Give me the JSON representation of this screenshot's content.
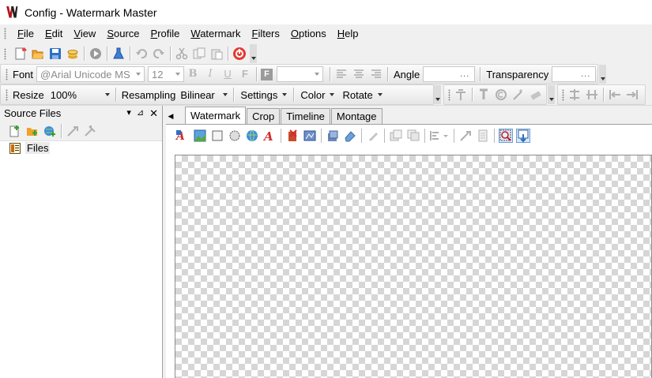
{
  "window": {
    "title": "Config - Watermark Master"
  },
  "menu": [
    "File",
    "Edit",
    "View",
    "Source",
    "Profile",
    "Watermark",
    "Filters",
    "Options",
    "Help"
  ],
  "toolbar_main": {
    "icons": [
      "new-icon",
      "open-icon",
      "save-icon",
      "coins-icon",
      "play-icon",
      "flask-icon",
      "undo-icon",
      "redo-icon",
      "cut-icon",
      "copy-icon",
      "paste-icon",
      "stop-icon"
    ]
  },
  "font_bar": {
    "font_label": "Font",
    "font_value": "@Arial Unicode MS",
    "size_value": "12",
    "bold": "B",
    "italic": "I",
    "underline": "U",
    "strike": "F",
    "frame": "F",
    "angle_label": "Angle",
    "angle_value": "...",
    "transparency_label": "Transparency",
    "transparency_value": "..."
  },
  "resize_bar": {
    "resize_label": "Resize",
    "resize_value": "100%",
    "resampling_label": "Resampling",
    "resampling_value": "Bilinear",
    "settings": "Settings",
    "color": "Color",
    "rotate": "Rotate"
  },
  "source_panel": {
    "title": "Source Files",
    "items": [
      {
        "label": "Files"
      }
    ]
  },
  "tabs": [
    {
      "label": "Watermark",
      "active": true
    },
    {
      "label": "Crop",
      "active": false
    },
    {
      "label": "Timeline",
      "active": false
    },
    {
      "label": "Montage",
      "active": false
    }
  ],
  "colors": {
    "accent_red": "#b0121b",
    "disabled_gray": "#b0b0b0",
    "checker": "#d6d6d6"
  }
}
